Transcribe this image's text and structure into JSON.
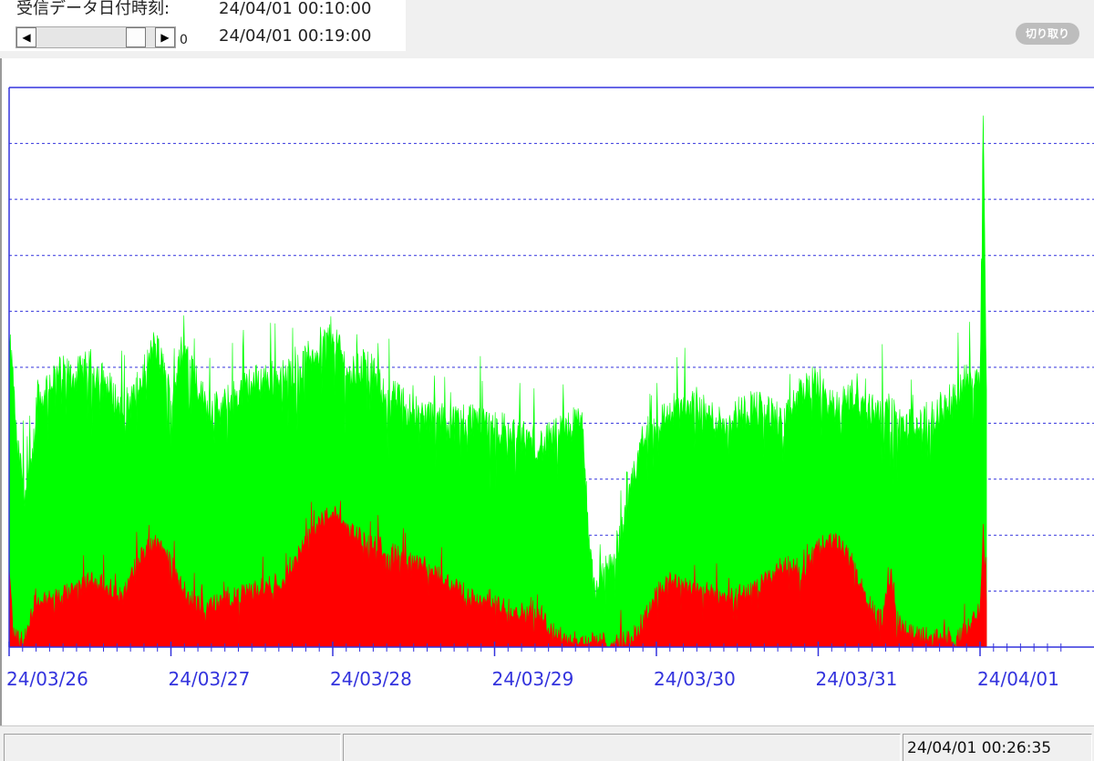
{
  "header": {
    "recv_label": "受信データ日付時刻:",
    "time_start": "24/04/01 00:10:00",
    "time_end": "24/04/01 00:19:00",
    "scroll_value": "0",
    "cut_button": "切り取り"
  },
  "status": {
    "timestamp": "24/04/01 00:26:35"
  },
  "colors": {
    "total": "#00ff00",
    "part": "#ff0000",
    "axis": "#3333dd",
    "grid": "#3333dd",
    "label": "#3333dd"
  },
  "chart_data": {
    "type": "area",
    "title": "",
    "xlabel": "",
    "ylabel": "",
    "x_tick_labels": [
      "24/03/26",
      "24/03/27",
      "24/03/28",
      "24/03/29",
      "24/03/30",
      "24/03/31",
      "24/04/01"
    ],
    "x_range_days": [
      0,
      6.5
    ],
    "ylim": [
      0,
      10
    ],
    "y_gridlines": [
      1,
      2,
      3,
      4,
      5,
      6,
      7,
      8,
      9
    ],
    "grid": true,
    "legend": "none",
    "x_unit": "days since 24/03/26 00:00",
    "series": [
      {
        "key": "total",
        "x": [
          0,
          0.02,
          0.05,
          0.1,
          0.14,
          0.18,
          0.2,
          0.22,
          0.3,
          0.4,
          0.5,
          0.6,
          0.7,
          0.8,
          0.9,
          0.95,
          1.0,
          1.05,
          1.1,
          1.2,
          1.3,
          1.4,
          1.5,
          1.6,
          1.7,
          1.8,
          1.9,
          2.0,
          2.05,
          2.1,
          2.2,
          2.3,
          2.5,
          2.7,
          2.9,
          3.1,
          3.3,
          3.4,
          3.5,
          3.55,
          3.58,
          3.62,
          3.7,
          3.8,
          3.9,
          4.0,
          4.1,
          4.2,
          4.4,
          4.6,
          4.8,
          4.9,
          5.0,
          5.1,
          5.2,
          5.3,
          5.4,
          5.5,
          5.6,
          5.7,
          5.8,
          5.85,
          5.9,
          5.95,
          6.0,
          6.02,
          6.04
        ],
        "y": [
          5.4,
          5.0,
          3.5,
          2.8,
          3.2,
          4.7,
          4.3,
          4.6,
          4.9,
          4.8,
          5.0,
          4.7,
          4.2,
          4.6,
          5.4,
          5.0,
          4.4,
          5.0,
          5.3,
          4.4,
          4.2,
          4.5,
          4.7,
          4.8,
          4.8,
          5.0,
          5.3,
          5.6,
          5.3,
          4.8,
          5.1,
          4.6,
          4.2,
          4.0,
          4.1,
          3.8,
          3.6,
          3.8,
          4.0,
          3.9,
          1.8,
          1.0,
          1.4,
          2.1,
          3.6,
          4.0,
          4.2,
          4.3,
          4.0,
          4.3,
          4.0,
          4.6,
          4.7,
          4.2,
          4.5,
          4.2,
          4.3,
          4.0,
          3.9,
          4.1,
          4.3,
          4.5,
          4.7,
          4.8,
          4.9,
          9.5,
          4.6
        ]
      },
      {
        "key": "part",
        "x": [
          0,
          0.02,
          0.04,
          0.08,
          0.12,
          0.16,
          0.2,
          0.3,
          0.4,
          0.5,
          0.6,
          0.7,
          0.8,
          0.9,
          0.95,
          1.0,
          1.05,
          1.1,
          1.2,
          1.3,
          1.4,
          1.5,
          1.6,
          1.7,
          1.8,
          1.9,
          2.0,
          2.1,
          2.2,
          2.3,
          2.5,
          2.7,
          2.9,
          3.1,
          3.3,
          3.4,
          3.5,
          3.6,
          3.8,
          3.9,
          4.0,
          4.1,
          4.2,
          4.4,
          4.6,
          4.8,
          4.9,
          5.0,
          5.1,
          5.2,
          5.3,
          5.4,
          5.45,
          5.5,
          5.6,
          5.7,
          5.8,
          5.9,
          6.0,
          6.02,
          6.04
        ],
        "y": [
          1.4,
          0.5,
          0.2,
          0.1,
          0.3,
          0.9,
          0.8,
          0.9,
          1.0,
          1.2,
          1.1,
          0.9,
          1.6,
          1.9,
          1.8,
          1.5,
          1.2,
          0.9,
          0.7,
          0.8,
          0.9,
          1.0,
          1.1,
          1.2,
          1.7,
          2.2,
          2.4,
          2.1,
          1.9,
          1.8,
          1.5,
          1.2,
          0.8,
          0.7,
          0.5,
          0.2,
          0.1,
          0.1,
          0.1,
          0.3,
          1.0,
          1.2,
          1.1,
          0.9,
          1.0,
          1.5,
          1.3,
          1.8,
          1.9,
          1.6,
          0.8,
          0.5,
          1.4,
          0.4,
          0.2,
          0.2,
          0.1,
          0.2,
          0.7,
          2.2,
          0.8
        ]
      }
    ]
  }
}
